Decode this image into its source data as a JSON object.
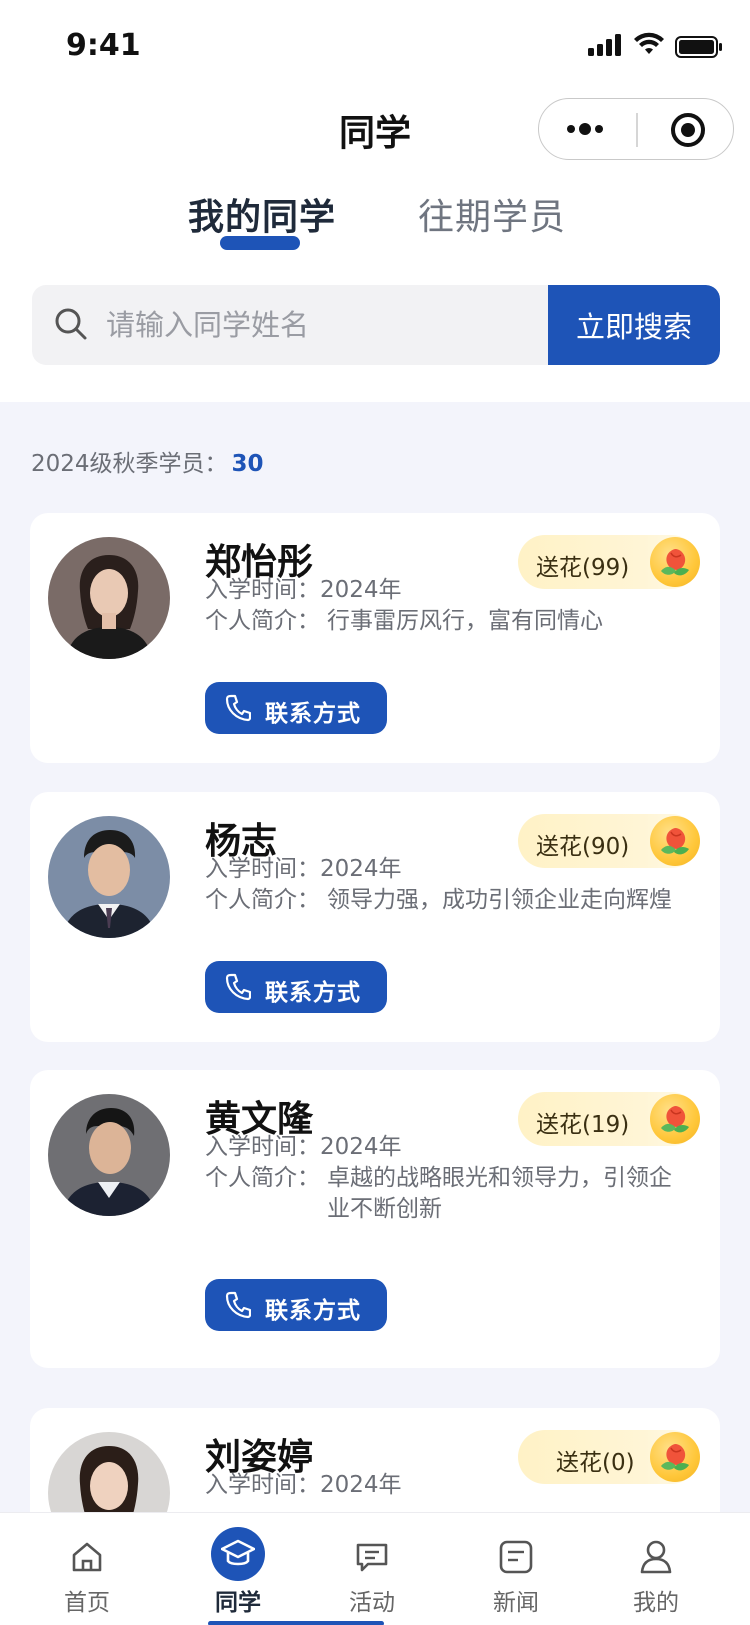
{
  "status_bar": {
    "time": "9:41"
  },
  "nav": {
    "title": "同学"
  },
  "tabs": [
    {
      "label": "我的同学",
      "active": true
    },
    {
      "label": "往期学员",
      "active": false
    }
  ],
  "search": {
    "placeholder": "请输入同学姓名",
    "value": "",
    "button_label": "立即搜索"
  },
  "summary": {
    "label": "2024级秋季学员：",
    "count": "30"
  },
  "meta_labels": {
    "enroll": "入学时间：",
    "intro": "个人简介：",
    "contact_button": "联系方式"
  },
  "students": [
    {
      "name": "郑怡彤",
      "flower": "送花(99)",
      "year": "2024年",
      "intro": "行事雷厉风行，富有同情心"
    },
    {
      "name": "杨志",
      "flower": "送花(90)",
      "year": "2024年",
      "intro": "领导力强，成功引领企业走向辉煌"
    },
    {
      "name": "黄文隆",
      "flower": "送花(19)",
      "year": "2024年",
      "intro": "卓越的战略眼光和领导力，引领企业不断创新"
    },
    {
      "name": "刘姿婷",
      "flower": "送花(0)",
      "year": "2024年",
      "intro": ""
    }
  ],
  "bottom_tabs": [
    {
      "label": "首页",
      "icon": "home-icon",
      "active": false
    },
    {
      "label": "同学",
      "icon": "graduation-cap-icon",
      "active": true
    },
    {
      "label": "活动",
      "icon": "chat-icon",
      "active": false
    },
    {
      "label": "新闻",
      "icon": "news-icon",
      "active": false
    },
    {
      "label": "我的",
      "icon": "person-icon",
      "active": false
    }
  ],
  "colors": {
    "accent": "#1e54b7",
    "background": "#f3f4fb",
    "flower_badge": "#fff2c6"
  }
}
